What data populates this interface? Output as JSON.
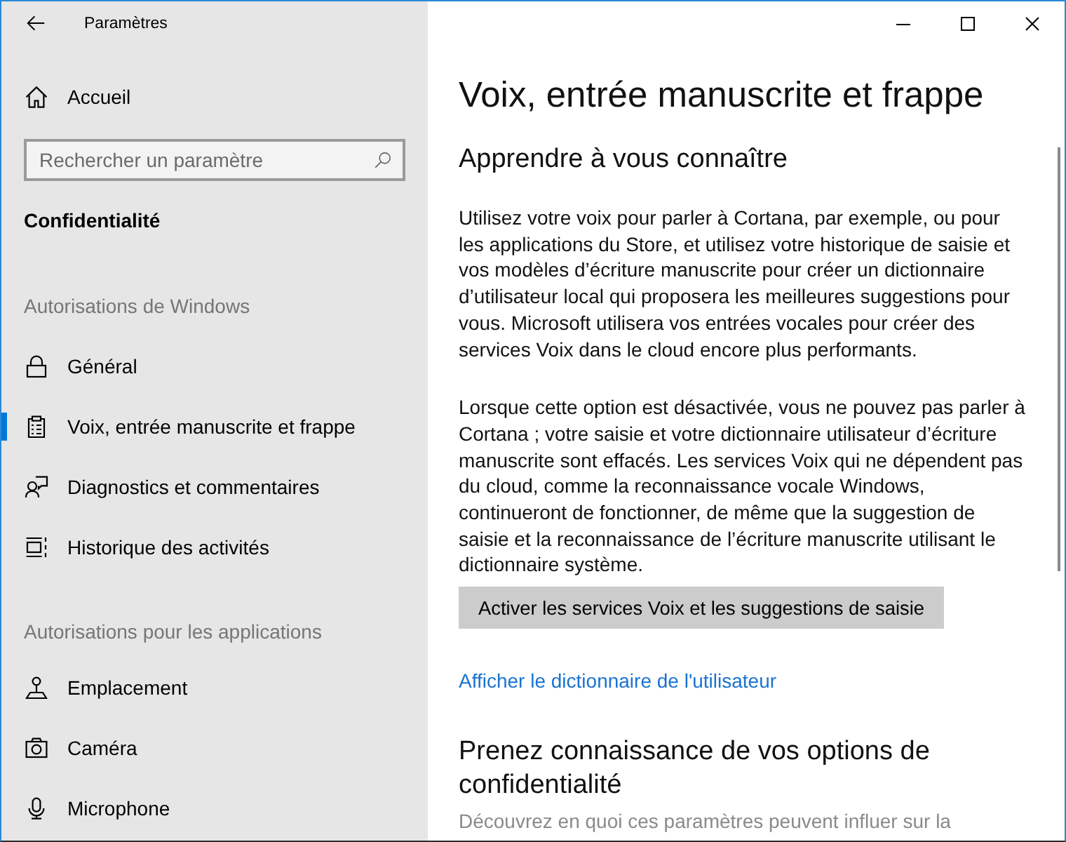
{
  "window": {
    "title": "Paramètres"
  },
  "sidebar": {
    "home": {
      "label": "Accueil"
    },
    "search": {
      "placeholder": "Rechercher un paramètre"
    },
    "category": "Confidentialité",
    "sections": [
      {
        "heading": "Autorisations de Windows",
        "items": [
          {
            "label": "Général",
            "selected": false
          },
          {
            "label": "Voix, entrée manuscrite et frappe",
            "selected": true
          },
          {
            "label": "Diagnostics et commentaires",
            "selected": false
          },
          {
            "label": "Historique des activités",
            "selected": false
          }
        ]
      },
      {
        "heading": "Autorisations pour les applications",
        "items": [
          {
            "label": "Emplacement",
            "selected": false
          },
          {
            "label": "Caméra",
            "selected": false
          },
          {
            "label": "Microphone",
            "selected": false
          }
        ]
      }
    ]
  },
  "main": {
    "title": "Voix, entrée manuscrite et frappe",
    "blocks": [
      {
        "kind": "heading",
        "text": "Apprendre à vous connaître"
      },
      {
        "kind": "paragraph",
        "text": "Utilisez votre voix pour parler à Cortana, par exemple, ou pour les applications du Store, et utilisez votre historique de saisie et vos modèles d’écriture manuscrite pour créer un dictionnaire d’utilisateur local qui proposera les meilleures suggestions pour vous. Microsoft utilisera vos entrées vocales pour créer des services Voix dans le cloud encore plus performants."
      },
      {
        "kind": "paragraph",
        "text": "Lorsque cette option est désactivée, vous ne pouvez pas parler à Cortana ; votre saisie et votre dictionnaire utilisateur d’écriture manuscrite sont effacés. Les services Voix qui ne dépendent pas du cloud, comme la reconnaissance vocale Windows, continueront de fonctionner, de même que la suggestion de saisie et la reconnaissance de l’écriture manuscrite utilisant le dictionnaire système."
      },
      {
        "kind": "button",
        "text": "Activer les services Voix et les suggestions de saisie"
      },
      {
        "kind": "link",
        "text": "Afficher le dictionnaire de l'utilisateur"
      },
      {
        "kind": "heading",
        "text": "Prenez connaissance de vos options de confidentialité"
      },
      {
        "kind": "note",
        "text": "Découvrez en quoi ces paramètres peuvent influer sur la"
      }
    ]
  }
}
